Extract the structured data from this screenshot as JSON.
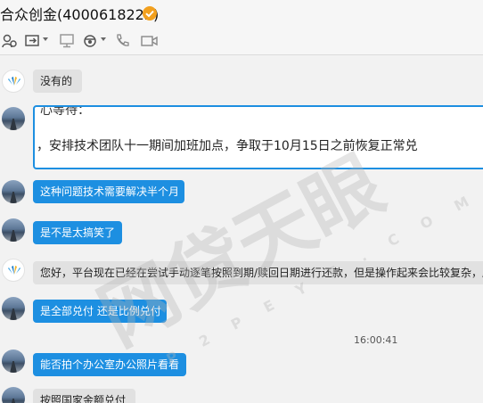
{
  "window": {
    "title": "合众创金(4000618222)"
  },
  "toolbar": {
    "icons": [
      "contacts-icon",
      "share-screen-icon",
      "remote-desktop-icon",
      "app-icon",
      "phone-icon",
      "video-icon"
    ]
  },
  "messages": [
    {
      "id": 1,
      "side": "them",
      "text": "没有的"
    },
    {
      "id": 2,
      "side": "them",
      "line1": "心等待：",
      "line2": "，安排技术团队十一期间加班加点，争取于10月15日之前恢复正常兑"
    },
    {
      "id": 3,
      "side": "me",
      "text": "这种问题技术需要解决半个月"
    },
    {
      "id": 4,
      "side": "me",
      "text": "是不是太搞笑了"
    },
    {
      "id": 5,
      "side": "them",
      "text": "您好，平台现在已经在尝试手动逐笔按照到期/赎回日期进行还款，但是操作起来会比较复杂，所"
    },
    {
      "id": 6,
      "side": "me",
      "text": "是全部兑付 还是比例兑付"
    },
    {
      "id": 7,
      "side": "me",
      "text": "能否拍个办公室办公照片看看"
    },
    {
      "id": 8,
      "side": "them",
      "text": "按照国家金额兑付"
    }
  ],
  "timestamp": "16:00:41",
  "watermark": {
    "main": "网贷天眼",
    "sub": "P 2 P E Y E . C O M"
  },
  "colors": {
    "self_bubble": "#1d8fe1",
    "other_bubble": "#e1e1e1",
    "verify_badge": "#f2a01e"
  }
}
